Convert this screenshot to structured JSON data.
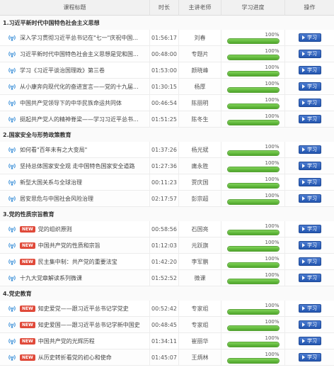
{
  "header": {
    "col_title": "课程标题",
    "col_duration": "时长",
    "col_teacher": "主讲老师",
    "col_progress": "学习进度",
    "col_action": "操作"
  },
  "colors": {
    "accent": "#2457b0",
    "progress": "#4ea52a",
    "new_badge": "#e04a3a"
  },
  "sections": [
    {
      "title": "1.习近平新时代中国特色社会主义思想",
      "rows": [
        {
          "icon": "broadcast-icon",
          "new": "",
          "title": "深入学习贯彻习近平总书记在\"七一\"庆祝中国...",
          "duration": "01:56:17",
          "teacher": "刘春",
          "progress_label": "100%",
          "progress": 1.0,
          "action": "学习"
        },
        {
          "icon": "broadcast-icon",
          "new": "",
          "title": "习近平新时代中国特色社会主义思想是党和国...",
          "duration": "00:48:00",
          "teacher": "专题片",
          "progress_label": "100%",
          "progress": 1.0,
          "action": "学习"
        },
        {
          "icon": "broadcast-icon",
          "new": "",
          "title": "学习《习近平谈治国理政》第三卷",
          "duration": "01:53:00",
          "teacher": "颜晓峰",
          "progress_label": "100%",
          "progress": 1.0,
          "action": "学习"
        },
        {
          "icon": "broadcast-icon",
          "new": "",
          "title": "从小康奔向现代化的奋进宣言——党的十九届...",
          "duration": "01:30:15",
          "teacher": "杨厚",
          "progress_label": "100%",
          "progress": 1.0,
          "action": "学习"
        },
        {
          "icon": "broadcast-icon",
          "new": "",
          "title": "中国共产党领导下的中华民族命运共同体",
          "duration": "00:46:54",
          "teacher": "陈丽明",
          "progress_label": "100%",
          "progress": 1.0,
          "action": "学习"
        },
        {
          "icon": "broadcast-icon",
          "new": "",
          "title": "挺起共产党人的精神脊梁——学习习近平总书...",
          "duration": "01:51:25",
          "teacher": "陈冬生",
          "progress_label": "100%",
          "progress": 1.0,
          "action": "学习"
        }
      ]
    },
    {
      "title": "2.国家安全与形势政策教育",
      "rows": [
        {
          "icon": "broadcast-icon",
          "new": "",
          "title": "如何看\"百年未有之大变局\"",
          "duration": "01:37:26",
          "teacher": "杨光斌",
          "progress_label": "100%",
          "progress": 1.0,
          "action": "学习"
        },
        {
          "icon": "broadcast-icon",
          "new": "",
          "title": "坚持总体国家安全观 走中国特色国家安全道路",
          "duration": "01:27:36",
          "teacher": "庸永胜",
          "progress_label": "100%",
          "progress": 1.0,
          "action": "学习"
        },
        {
          "icon": "broadcast-icon",
          "new": "",
          "title": "新型大国关系与全球治理",
          "duration": "00:11:23",
          "teacher": "贾庆国",
          "progress_label": "100%",
          "progress": 1.0,
          "action": "学习"
        },
        {
          "icon": "broadcast-icon",
          "new": "",
          "title": "居安思危与中国社会风险治理",
          "duration": "02:17:57",
          "teacher": "彭宗超",
          "progress_label": "100%",
          "progress": 1.0,
          "action": "学习"
        }
      ]
    },
    {
      "title": "3.党的性质宗旨教育",
      "rows": [
        {
          "icon": "broadcast-icon",
          "new": "NEW",
          "title": "党的组织原则",
          "duration": "00:58:56",
          "teacher": "石国亮",
          "progress_label": "100%",
          "progress": 1.0,
          "action": "学习"
        },
        {
          "icon": "broadcast-icon",
          "new": "NEW",
          "title": "中国共产党的性质和宗旨",
          "duration": "01:12:03",
          "teacher": "元跃旗",
          "progress_label": "100%",
          "progress": 1.0,
          "action": "学习"
        },
        {
          "icon": "broadcast-icon",
          "new": "NEW",
          "title": "民主集中制：共产党的重要法宝",
          "duration": "01:42:20",
          "teacher": "李军鹏",
          "progress_label": "100%",
          "progress": 1.0,
          "action": "学习"
        },
        {
          "icon": "broadcast-icon",
          "new": "",
          "title": "十九大党章解读系列微课",
          "duration": "01:52:52",
          "teacher": "微课",
          "progress_label": "100%",
          "progress": 1.0,
          "action": "学习"
        }
      ]
    },
    {
      "title": "4.党史教育",
      "rows": [
        {
          "icon": "broadcast-icon",
          "new": "NEW",
          "title": "知史爱党——跟习近平总书记学党史",
          "duration": "00:52:42",
          "teacher": "专家组",
          "progress_label": "100%",
          "progress": 1.0,
          "action": "学习"
        },
        {
          "icon": "broadcast-icon",
          "new": "NEW",
          "title": "知史爱国——跟习近平总书记学新中国史",
          "duration": "00:48:45",
          "teacher": "专家组",
          "progress_label": "100%",
          "progress": 1.0,
          "action": "学习"
        },
        {
          "icon": "broadcast-icon",
          "new": "NEW",
          "title": "中国共产党的光辉历程",
          "duration": "01:34:11",
          "teacher": "崔丽华",
          "progress_label": "100%",
          "progress": 1.0,
          "action": "学习"
        },
        {
          "icon": "broadcast-icon",
          "new": "NEW",
          "title": "从历史转折看党的初心和使命",
          "duration": "01:45:07",
          "teacher": "王炳林",
          "progress_label": "100%",
          "progress": 1.0,
          "action": "学习"
        }
      ]
    }
  ]
}
